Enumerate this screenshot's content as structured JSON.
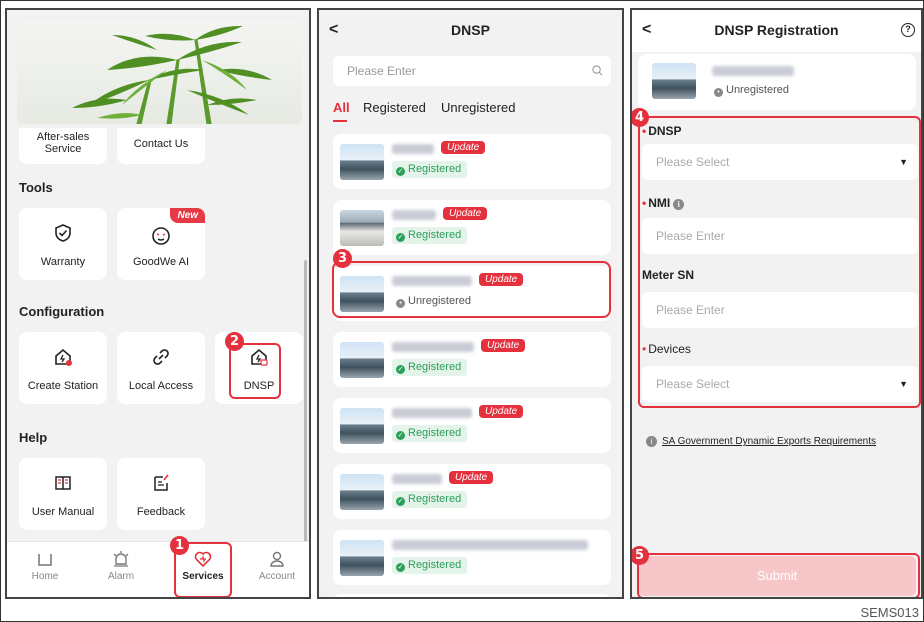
{
  "figure": {
    "caption": "SEMS013"
  },
  "services_screen": {
    "cards_top": [
      {
        "label": "After-sales Service"
      },
      {
        "label": "Contact Us"
      }
    ],
    "tools": {
      "title": "Tools",
      "items": [
        {
          "label": "Warranty",
          "icon": "shield-check-icon"
        },
        {
          "label": "GoodWe AI",
          "icon": "ai-chat-icon",
          "tag": "New"
        }
      ]
    },
    "configuration": {
      "title": "Configuration",
      "items": [
        {
          "label": "Create Station",
          "icon": "add-station-icon"
        },
        {
          "label": "Local Access",
          "icon": "link-icon"
        },
        {
          "label": "DNSP",
          "icon": "dnsp-icon"
        }
      ]
    },
    "help": {
      "title": "Help",
      "items": [
        {
          "label": "User Manual",
          "icon": "book-icon"
        },
        {
          "label": "Feedback",
          "icon": "feedback-icon"
        }
      ]
    },
    "tabbar": [
      {
        "label": "Home",
        "icon": "home-icon"
      },
      {
        "label": "Alarm",
        "icon": "bell-icon"
      },
      {
        "label": "Services",
        "icon": "heart-service-icon",
        "active": true
      },
      {
        "label": "Account",
        "icon": "person-icon"
      }
    ]
  },
  "dnsp_list_screen": {
    "title": "DNSP",
    "back": "<",
    "search_placeholder": "Please Enter",
    "filters": [
      {
        "label": "All",
        "active": true
      },
      {
        "label": "Registered"
      },
      {
        "label": "Unregistered"
      }
    ],
    "items": [
      {
        "status": "Registered",
        "update": "Update"
      },
      {
        "status": "Registered",
        "update": "Update"
      },
      {
        "status": "Unregistered",
        "update": "Update"
      },
      {
        "status": "Registered",
        "update": "Update"
      },
      {
        "status": "Registered",
        "update": "Update"
      },
      {
        "status": "Registered",
        "update": "Update"
      },
      {
        "status": "Registered",
        "update": ""
      }
    ]
  },
  "registration_screen": {
    "title": "DNSP Registration",
    "back": "<",
    "help_icon": "?",
    "plant_status": "Unregistered",
    "fields": {
      "dnsp": {
        "label": "DNSP",
        "placeholder": "Please Select",
        "required": true
      },
      "nmi": {
        "label": "NMI",
        "placeholder": "Please Enter",
        "required": true
      },
      "meter_sn": {
        "label": "Meter SN",
        "placeholder": "Please Enter",
        "required": false
      },
      "devices": {
        "label": "Devices",
        "placeholder": "Please Select",
        "required": true
      }
    },
    "link": "SA Government Dynamic Exports Requirements",
    "submit": "Submit"
  },
  "step_markers": [
    "1",
    "2",
    "3",
    "4",
    "5"
  ],
  "colors": {
    "accent": "#e5303d",
    "registered": "#2ca05a",
    "screen_bg": "#f2f2f2",
    "submit_disabled": "#f6c6c9"
  }
}
